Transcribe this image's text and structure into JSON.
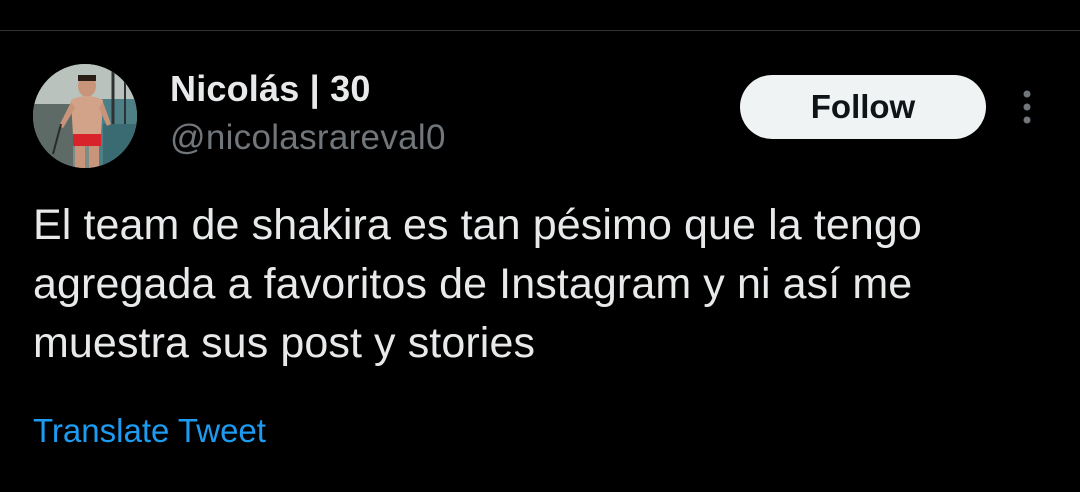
{
  "author": {
    "display_name": "Nicolás | 30",
    "handle": "@nicolasrareval0"
  },
  "actions": {
    "follow_label": "Follow",
    "more_icon": "more-vertical-icon"
  },
  "tweet": {
    "text": "El team de shakira es tan pésimo que la tengo agregada a favoritos de Instagram y ni así me muestra sus post y stories",
    "translate_label": "Translate Tweet"
  },
  "colors": {
    "background": "#000000",
    "primary_text": "#e7e9ea",
    "secondary_text": "#71767b",
    "link": "#1d9bf0",
    "follow_button_bg": "#eff3f4"
  }
}
